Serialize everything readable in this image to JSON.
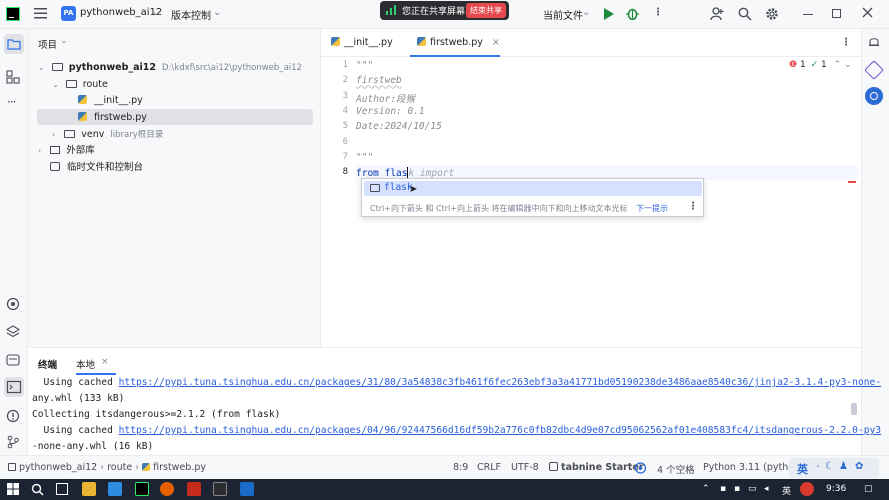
{
  "titlebar": {
    "project_badge": "PA",
    "project_name": "pythonweb_ai12",
    "vcs": "版本控制",
    "share_label": "您正在共享屏幕",
    "share_end": "结束共享",
    "run_config": "当前文件"
  },
  "project_panel": {
    "title": "项目",
    "root_name": "pythonweb_ai12",
    "root_path": "D:\\kdxf\\src\\ai12\\pythonweb_ai12",
    "folder_route": "route",
    "file_init": "__init__.py",
    "file_firstweb": "firstweb.py",
    "folder_venv": "venv",
    "venv_sub": "library根目录",
    "external_libs": "外部库",
    "scratches": "临时文件和控制台"
  },
  "editor": {
    "tabs": [
      {
        "label": "__init__.py"
      },
      {
        "label": "firstweb.py"
      }
    ],
    "inspections": {
      "errors": "1",
      "warnings": "1"
    },
    "line_numbers": [
      "1",
      "2",
      "3",
      "4",
      "5",
      "6",
      "7",
      "8"
    ],
    "lines": [
      "\"\"\"",
      "firstweb",
      "Author:段猴",
      "Version: 0.1",
      "Date:2024/10/15",
      "",
      "\"\"\"",
      "from flask import"
    ],
    "line8_typed": "from flas",
    "line8_ghost": "k import",
    "completion": {
      "item": "flask",
      "hint": "Ctrl+向下箭头 和 Ctrl+向上箭头 将在编辑器中向下和向上移动文本光标",
      "hint_link": "下一提示"
    }
  },
  "terminal": {
    "tabs": [
      "终端",
      "本地"
    ],
    "lines": [
      {
        "prefix": "  Using cached ",
        "link": "https://pypi.tuna.tsinghua.edu.cn/packages/31/80/3a54838c3fb461f6fec263ebf3a3a41771bd05190238de3486aae8540c36/jinja2-3.1.4-py3-none-",
        "suffix": ""
      },
      {
        "prefix": "any.whl (133 kB)",
        "link": "",
        "suffix": ""
      },
      {
        "prefix": "Collecting itsdangerous>=2.1.2 (from flask)",
        "link": "",
        "suffix": ""
      },
      {
        "prefix": "  Using cached ",
        "link": "https://pypi.tuna.tsinghua.edu.cn/packages/04/96/92447566d16df59b2a776c0fb82dbc4d9e07cd95062562af01e408583fc4/itsdangerous-2.2.0-py3",
        "suffix": ""
      },
      {
        "prefix": "-none-any.whl (16 kB)",
        "link": "",
        "suffix": ""
      }
    ]
  },
  "statusbar": {
    "breadcrumb": [
      "pythonweb_ai12",
      "route",
      "firstweb.py"
    ],
    "position": "8:9",
    "line_sep": "CRLF",
    "encoding": "UTF-8",
    "tabnine": "tabnine Starter",
    "indent": "4 个空格",
    "interpreter": "Python 3.11 (pytho",
    "ime": "英"
  },
  "taskbar": {
    "ime": "英",
    "clock": "9:36"
  }
}
